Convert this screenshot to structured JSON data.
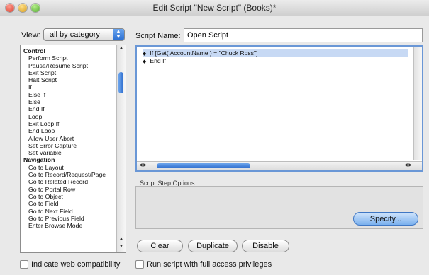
{
  "window": {
    "title": "Edit Script \"New Script\" (Books)*"
  },
  "view": {
    "label": "View:",
    "selected": "all by category"
  },
  "script_name": {
    "label": "Script Name:",
    "value": "Open Script"
  },
  "steps": [
    {
      "type": "cat",
      "label": "Control"
    },
    {
      "type": "item",
      "label": "Perform Script"
    },
    {
      "type": "item",
      "label": "Pause/Resume Script"
    },
    {
      "type": "item",
      "label": "Exit Script"
    },
    {
      "type": "item",
      "label": "Halt Script"
    },
    {
      "type": "item",
      "label": "If"
    },
    {
      "type": "item",
      "label": "Else If"
    },
    {
      "type": "item",
      "label": "Else"
    },
    {
      "type": "item",
      "label": "End If"
    },
    {
      "type": "item",
      "label": "Loop"
    },
    {
      "type": "item",
      "label": "Exit Loop If"
    },
    {
      "type": "item",
      "label": "End Loop"
    },
    {
      "type": "item",
      "label": "Allow User Abort"
    },
    {
      "type": "item",
      "label": "Set Error Capture"
    },
    {
      "type": "item",
      "label": "Set Variable"
    },
    {
      "type": "cat",
      "label": "Navigation"
    },
    {
      "type": "item",
      "label": "Go to Layout"
    },
    {
      "type": "item",
      "label": "Go to Record/Request/Page"
    },
    {
      "type": "item",
      "label": "Go to Related Record"
    },
    {
      "type": "item",
      "label": "Go to Portal Row"
    },
    {
      "type": "item",
      "label": "Go to Object"
    },
    {
      "type": "item",
      "label": "Go to Field"
    },
    {
      "type": "item",
      "label": "Go to Next Field"
    },
    {
      "type": "item",
      "label": "Go to Previous Field"
    },
    {
      "type": "item",
      "label": "Enter Browse Mode"
    }
  ],
  "script_lines": [
    {
      "text": "If [Get( AccountName ) = \"Chuck Ross\"]",
      "selected": true
    },
    {
      "text": "End If",
      "selected": false
    }
  ],
  "options": {
    "label": "Script Step Options",
    "specify_label": "Specify..."
  },
  "buttons": {
    "clear": "Clear",
    "duplicate": "Duplicate",
    "disable": "Disable"
  },
  "checkboxes": {
    "web_compat": {
      "label": "Indicate web compatibility",
      "checked": false
    },
    "full_access": {
      "label": "Run script with full access privileges",
      "checked": false
    }
  },
  "icons": {
    "close": "close-icon",
    "minimize": "minimize-icon",
    "zoom": "zoom-icon",
    "step_marker": "diamond-bullet-icon"
  },
  "colors": {
    "accent": "#2c6cce",
    "selection": "#c7d9f4"
  }
}
